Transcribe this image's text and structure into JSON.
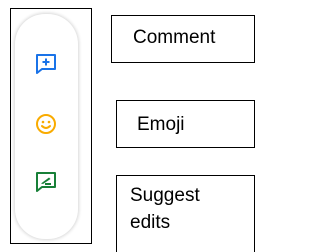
{
  "toolbar": {
    "buttons": [
      {
        "icon": "add-comment-icon",
        "color": "#1a73e8"
      },
      {
        "icon": "emoji-icon",
        "color": "#f9ab00"
      },
      {
        "icon": "suggest-edits-icon",
        "color": "#188038"
      }
    ]
  },
  "labels": {
    "comment": "Comment",
    "emoji": "Emoji",
    "suggest_edits": "Suggest edits"
  }
}
